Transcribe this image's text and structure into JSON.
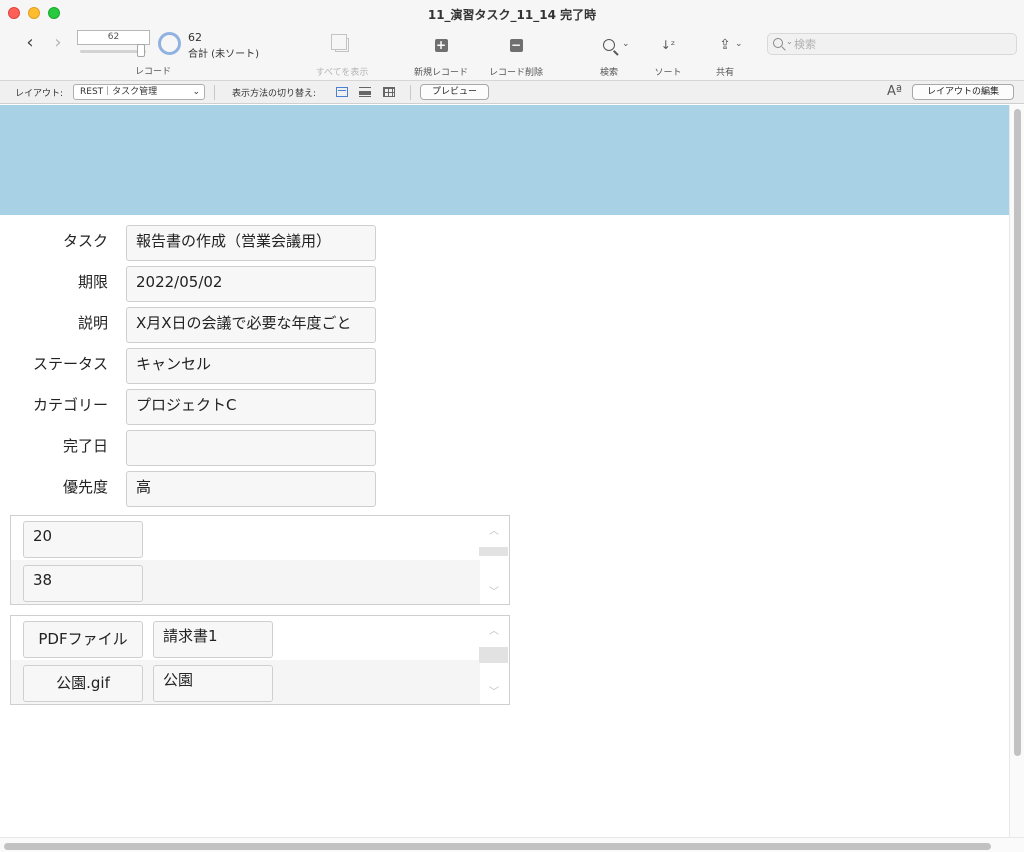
{
  "window": {
    "title": "11_演習タスク_11_14 完了時"
  },
  "toolbar": {
    "record_number": "62",
    "record_count": "62",
    "record_status": "合計 (未ソート)",
    "record_label": "レコード",
    "show_all_label": "すべてを表示",
    "new_record_label": "新規レコード",
    "delete_record_label": "レコード削除",
    "find_label": "検索",
    "sort_label": "ソート",
    "share_label": "共有",
    "search_placeholder": "検索"
  },
  "layoutbar": {
    "layout_label": "レイアウト:",
    "layout_value": "REST｜タスク管理",
    "view_as_label": "表示方法の切り替え:",
    "preview_label": "プレビュー",
    "edit_layout_label": "レイアウトの編集",
    "font_icon_text": "Aª"
  },
  "record": {
    "fields": [
      {
        "label": "タスク",
        "value": "報告書の作成（営業会議用）"
      },
      {
        "label": "期限",
        "value": "2022/05/02"
      },
      {
        "label": "説明",
        "value": "X月X日の会議で必要な年度ごと"
      },
      {
        "label": "ステータス",
        "value": "キャンセル"
      },
      {
        "label": "カテゴリー",
        "value": "プロジェクトC"
      },
      {
        "label": "完了日",
        "value": ""
      },
      {
        "label": "優先度",
        "value": "高"
      }
    ]
  },
  "portal1": {
    "rows": [
      {
        "value": "20"
      },
      {
        "value": "38"
      }
    ]
  },
  "portal2": {
    "rows": [
      {
        "button": "PDFファイル",
        "value": "請求書1"
      },
      {
        "button": "公園.gif",
        "value": "公園"
      }
    ]
  },
  "icons": {
    "scroll_up": "︿",
    "scroll_down": "﹀"
  },
  "colors": {
    "header_band": "#a8d1e6",
    "accent": "#4a7fd4"
  }
}
